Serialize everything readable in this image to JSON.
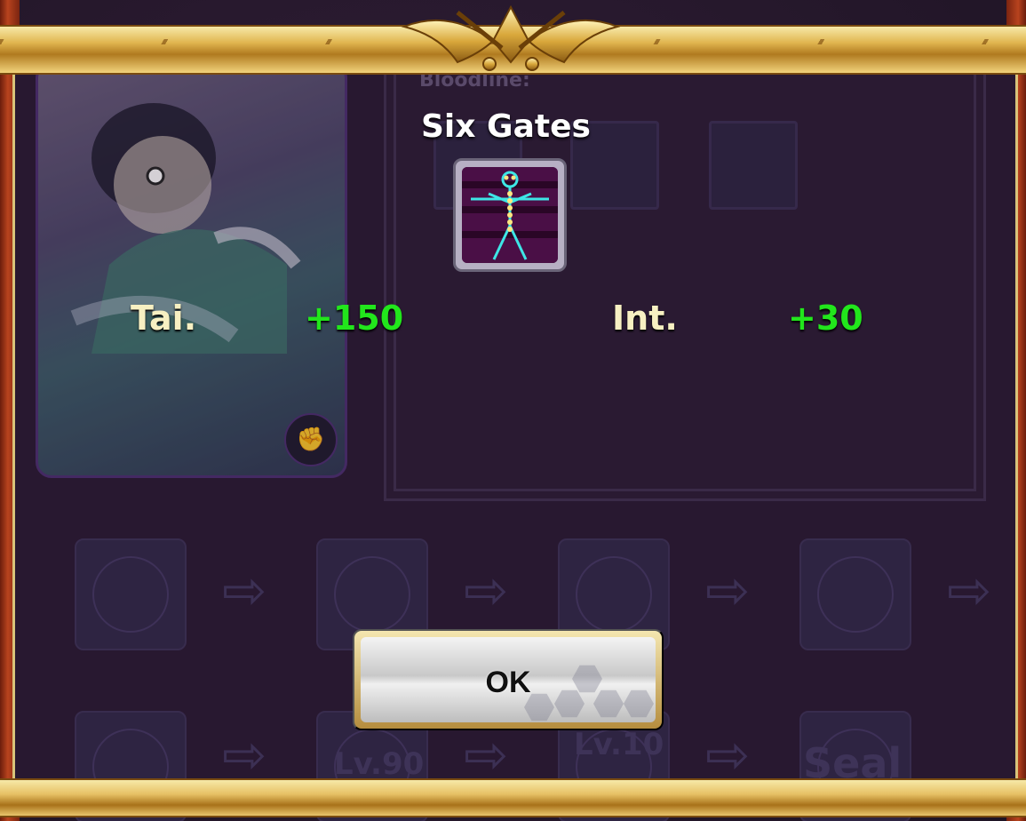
{
  "background": {
    "bloodline_label": "Bloodline:",
    "locked_levels": [
      "Lv.90",
      "Lv.10",
      "Seal"
    ]
  },
  "popup": {
    "skill_name": "Six Gates",
    "skill_icon": "chakra-gates-body-icon",
    "stats": [
      {
        "label": "Tai.",
        "value": "+150"
      },
      {
        "label": "Int.",
        "value": "+30"
      }
    ],
    "ok_label": "OK"
  },
  "colors": {
    "stat_label": "#f7f0c2",
    "stat_value": "#22e61c",
    "gold_frame": "#e0b54f"
  }
}
